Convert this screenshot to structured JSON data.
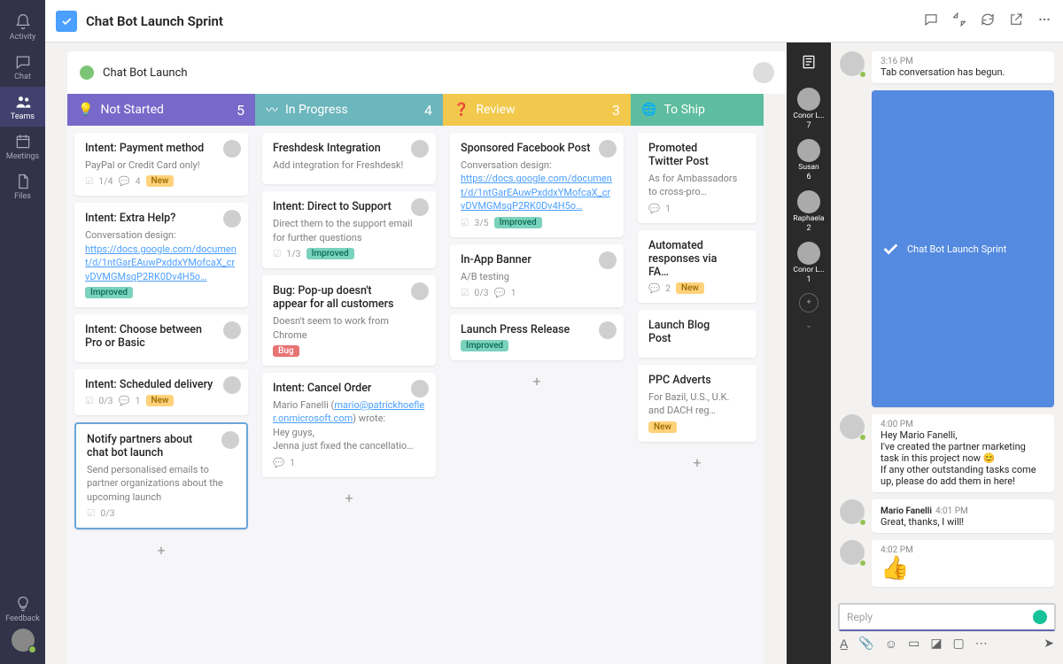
{
  "nav": {
    "items": [
      {
        "label": "Activity"
      },
      {
        "label": "Chat"
      },
      {
        "label": "Teams"
      },
      {
        "label": "Meetings"
      },
      {
        "label": "Files"
      }
    ],
    "feedback": "Feedback"
  },
  "top": {
    "title": "Chat Bot Launch Sprint"
  },
  "board": {
    "title": "Chat Bot Launch"
  },
  "columns": [
    {
      "name": "Not Started",
      "count": "5"
    },
    {
      "name": "In Progress",
      "count": "4"
    },
    {
      "name": "Review",
      "count": "3"
    },
    {
      "name": "To Ship",
      "count": ""
    }
  ],
  "cards": {
    "c0": [
      {
        "title": "Intent: Payment method",
        "desc": "PayPal or Credit Card only!",
        "sub": "1/4",
        "comments": "4",
        "tag": "New"
      },
      {
        "title": "Intent: Extra Help?",
        "desc": "Conversation design:",
        "link": "https://docs.google.com/document/d/1ntGarEAuwPxddxYMofcaX_crvDVMGMsqP2RK0Dv4H5o…",
        "tag": "Improved"
      },
      {
        "title": "Intent: Choose between Pro or Basic"
      },
      {
        "title": "Intent: Scheduled delivery",
        "sub": "0/3",
        "comments": "1",
        "tag": "New"
      },
      {
        "title": "Notify partners about chat bot launch",
        "desc": "Send personalised emails to partner organizations about the upcoming launch",
        "sub": "0/3",
        "selected": true
      }
    ],
    "c1": [
      {
        "title": "Freshdesk Integration",
        "desc": "Add integration for Freshdesk!"
      },
      {
        "title": "Intent: Direct to Support",
        "desc": "Direct them to the support email for further questions",
        "sub": "1/3",
        "tag": "Improved"
      },
      {
        "title": "Bug: Pop-up doesn't appear for all customers",
        "desc": "Doesn't seem to work from Chrome",
        "tag": "Bug"
      },
      {
        "title": "Intent: Cancel Order",
        "desc": "Mario Fanelli (",
        "link": "mario@patrickhoefler.onmicrosoft.com",
        "desc2": ") wrote:\nHey guys,\nJenna just fixed the cancellatio…",
        "comments": "1"
      }
    ],
    "c2": [
      {
        "title": "Sponsored Facebook Post",
        "desc": "Conversation design:",
        "link": "https://docs.google.com/document/d/1ntGarEAuwPxddxYMofcaX_crvDVMGMsqP2RK0Dv4H5o…",
        "sub": "3/5",
        "tag": "Improved"
      },
      {
        "title": "In-App Banner",
        "desc": "A/B testing",
        "sub": "0/3",
        "comments": "1"
      },
      {
        "title": "Launch Press Release",
        "tag": "Improved"
      }
    ],
    "c3": [
      {
        "title": "Promoted Twitter Post",
        "desc": "As for Ambassadors to cross-pro…",
        "comments": "1"
      },
      {
        "title": "Automated responses via FA…",
        "comments": "2",
        "tag": "New"
      },
      {
        "title": "Launch Blog Post"
      },
      {
        "title": "PPC Adverts",
        "desc": "For Bazil, U.S., U.K. and DACH reg…",
        "tag": "New"
      }
    ]
  },
  "people": [
    {
      "name": "Conor L…",
      "count": "7"
    },
    {
      "name": "Susan",
      "count": "6"
    },
    {
      "name": "Raphaela",
      "count": "2"
    },
    {
      "name": "Conor L…",
      "count": "1"
    }
  ],
  "chat": {
    "m0": {
      "time": "3:16 PM",
      "text": "Tab conversation has begun."
    },
    "m1": {
      "text": "Chat Bot Launch Sprint"
    },
    "m2": {
      "time": "4:00 PM",
      "text": "Hey Mario Fanelli,\nI've created the partner marketing task in this project now 😊\nIf any other outstanding tasks come up, please do add them in here!"
    },
    "m3": {
      "name": "Mario Fanelli",
      "time": "4:01 PM",
      "text": "Great, thanks, I will!"
    },
    "m4": {
      "time": "4:02 PM",
      "emoji": "👍"
    },
    "placeholder": "Reply"
  }
}
